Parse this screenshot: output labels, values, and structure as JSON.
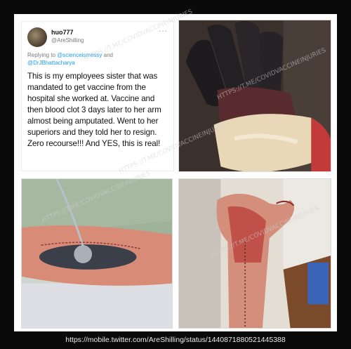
{
  "tweet": {
    "display_name": "huo777",
    "handle": "@AreShilling",
    "more": "···",
    "replying_prefix": "Replying to",
    "mention_1": "@scienceismessy",
    "and": "and",
    "mention_2": "@DrJBhattacharya",
    "body": "This is my employees sister that was mandated to get vaccine from the hospital she worked at. Vaccine and then blood clot 3 days later to her arm almost being amputated. Went to her superiors and they told her to resign. Zero recourse!!! And YES, this is real!"
  },
  "watermark": "HTTPS://T.ME/COVIDVACCINEINJURIES",
  "source_url": "https://mobile.twitter.com/AreShilling/status/1440871880521445388",
  "colors": {
    "background": "#0a0a0a",
    "mention": "#1d9bf0",
    "text": "#111111"
  }
}
